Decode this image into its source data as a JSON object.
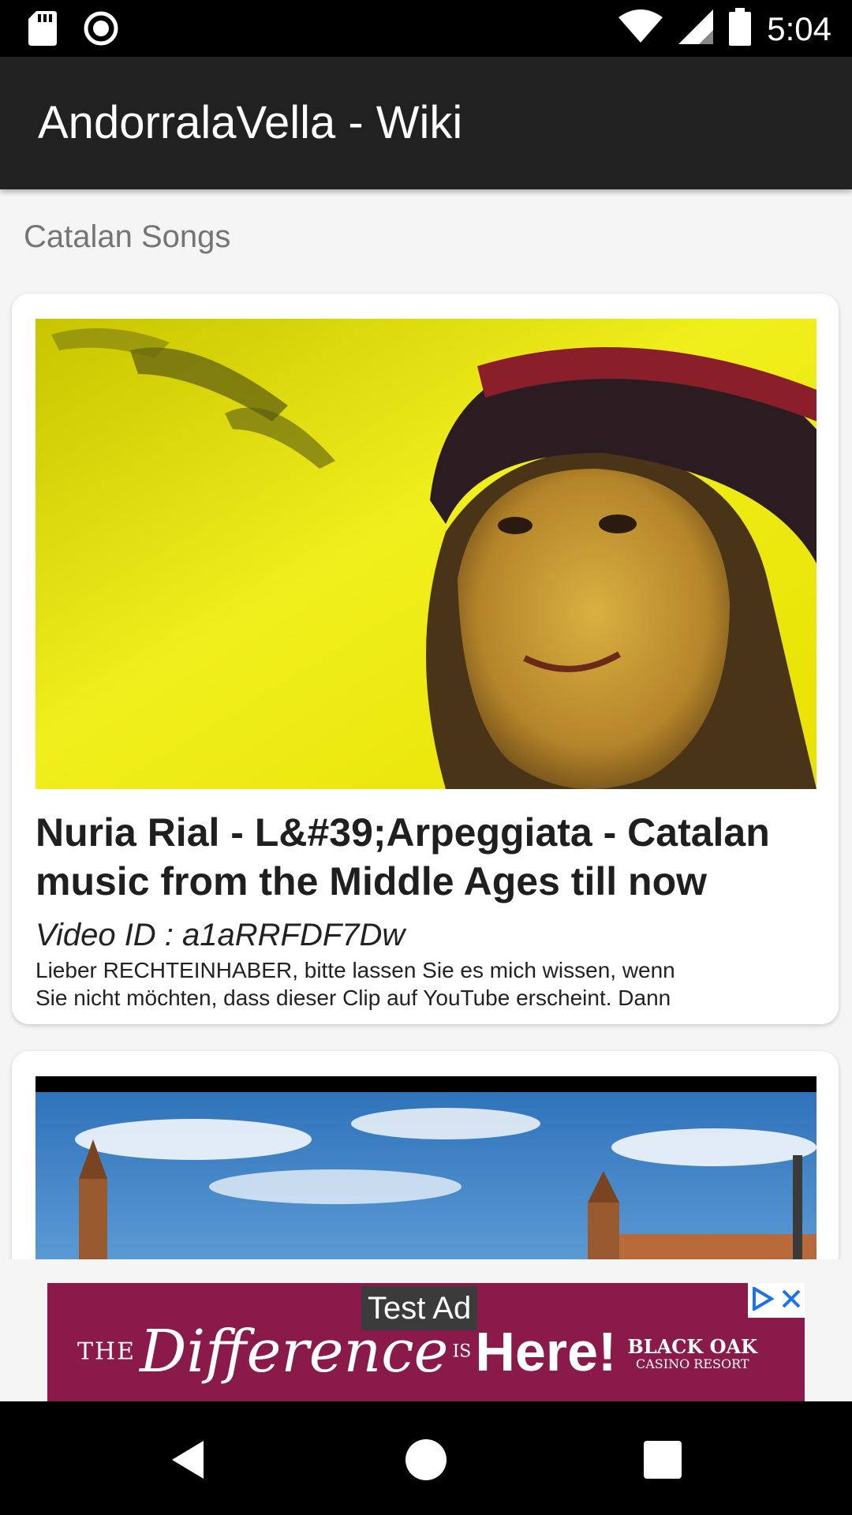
{
  "status_bar": {
    "time": "5:04",
    "icons": [
      "sd-card-icon",
      "record-icon",
      "wifi-icon",
      "signal-icon",
      "battery-icon"
    ]
  },
  "app_bar": {
    "title": "AndorralaVella - Wiki"
  },
  "section": {
    "label": "Catalan Songs"
  },
  "videos": [
    {
      "title": "Nuria Rial - L&#39;Arpeggiata - Catalan music from the Middle Ages till now",
      "video_id": "Video ID : a1aRRFDF7Dw",
      "description_line1": "Lieber RECHTEINHABER, bitte lassen Sie es mich wissen, wenn",
      "description_line2": "Sie nicht möchten, dass dieser Clip auf YouTube erscheint. Dann"
    }
  ],
  "ad": {
    "label": "Test Ad",
    "tagline_the": "THE",
    "tagline_difference": "Difference",
    "tagline_is": "IS",
    "tagline_here": "Here!",
    "brand_line1": "BLACK OAK",
    "brand_line2": "CASINO RESORT",
    "colors": {
      "background": "#8a1a4a",
      "adchoices": "#1a73e8"
    }
  },
  "nav_bar": {
    "buttons": [
      "back-icon",
      "home-icon",
      "recents-icon"
    ]
  },
  "colors": {
    "app_bar": "#212121",
    "status_bar": "#000000",
    "background": "#f5f5f5"
  }
}
